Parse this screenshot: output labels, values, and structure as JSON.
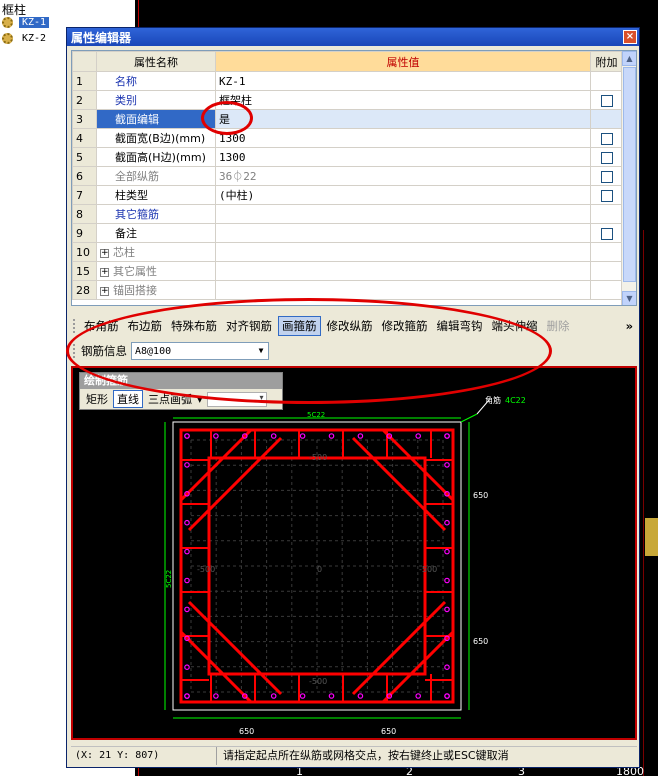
{
  "tree": {
    "title": "框柱",
    "items": [
      {
        "label": "KZ-1",
        "selected": true
      },
      {
        "label": "KZ-2",
        "selected": false
      }
    ]
  },
  "window": {
    "title": "属性编辑器",
    "close_glyph": "×"
  },
  "grid": {
    "headers": {
      "name": "属性名称",
      "value": "属性值",
      "extra": "附加"
    },
    "rows": [
      {
        "num": "1",
        "name": "名称",
        "value": "KZ-1",
        "style": "blue",
        "checkbox": false
      },
      {
        "num": "2",
        "name": "类别",
        "value": "框架柱",
        "style": "blue",
        "checkbox": true
      },
      {
        "num": "3",
        "name": "截面编辑",
        "value": "是",
        "style": "blue",
        "checkbox": false,
        "selected": true
      },
      {
        "num": "4",
        "name": "截面宽(B边)(mm)",
        "value": "1300",
        "style": "normal",
        "checkbox": true
      },
      {
        "num": "5",
        "name": "截面高(H边)(mm)",
        "value": "1300",
        "style": "normal",
        "checkbox": true
      },
      {
        "num": "6",
        "name": "全部纵筋",
        "value": "36⏀22",
        "style": "gray",
        "checkbox": true
      },
      {
        "num": "7",
        "name": "柱类型",
        "value": "(中柱)",
        "style": "normal",
        "checkbox": true
      },
      {
        "num": "8",
        "name": "其它箍筋",
        "value": "",
        "style": "blue",
        "checkbox": false
      },
      {
        "num": "9",
        "name": "备注",
        "value": "",
        "style": "normal",
        "checkbox": true
      },
      {
        "num": "10",
        "name": "芯柱",
        "value": "",
        "style": "gray",
        "checkbox": false,
        "expand": true
      },
      {
        "num": "15",
        "name": "其它属性",
        "value": "",
        "style": "gray",
        "checkbox": false,
        "expand": true
      },
      {
        "num": "28",
        "name": "锚固搭接",
        "value": "",
        "style": "gray",
        "checkbox": false,
        "expand": true
      }
    ]
  },
  "toolbar": {
    "buttons": [
      {
        "label": "布角筋",
        "state": "normal"
      },
      {
        "label": "布边筋",
        "state": "normal"
      },
      {
        "label": "特殊布筋",
        "state": "normal"
      },
      {
        "label": "对齐钢筋",
        "state": "normal"
      },
      {
        "label": "画箍筋",
        "state": "active"
      },
      {
        "label": "修改纵筋",
        "state": "normal"
      },
      {
        "label": "修改箍筋",
        "state": "normal"
      },
      {
        "label": "编辑弯钩",
        "state": "normal"
      },
      {
        "label": "端头伸缩",
        "state": "normal"
      },
      {
        "label": "删除",
        "state": "disabled"
      }
    ],
    "more": "»"
  },
  "rebar": {
    "label": "钢筋信息",
    "value": "A8@100"
  },
  "draw_tool": {
    "title": "绘制箍筋",
    "buttons": [
      {
        "label": "矩形",
        "active": false
      },
      {
        "label": "直线",
        "active": true
      },
      {
        "label": "三点画弧",
        "active": false
      }
    ],
    "combo_arrow": "▾"
  },
  "drawing": {
    "corner_label": "角筋",
    "corner_value": "4C22",
    "top_label": "5C22",
    "left_label": "5C22",
    "dim_right_top": "650",
    "dim_right_bottom": "650",
    "dim_bottom_left": "650",
    "dim_bottom_right": "650",
    "grid_labels": [
      "-500",
      "-500",
      "0",
      "-500",
      "-500"
    ]
  },
  "status": {
    "coord": "(X: 21 Y: 807)",
    "message": "请指定起点所在纵筋或网格交点，按右键终止或ESC键取消"
  },
  "colors": {
    "accent_blue": "#3169c6",
    "stirrup_red": "#ff0000",
    "dim_green": "#00ff00",
    "rebar_magenta": "#ff00ff"
  },
  "bottom_numbers": [
    "1",
    "2",
    "3",
    "1800"
  ]
}
